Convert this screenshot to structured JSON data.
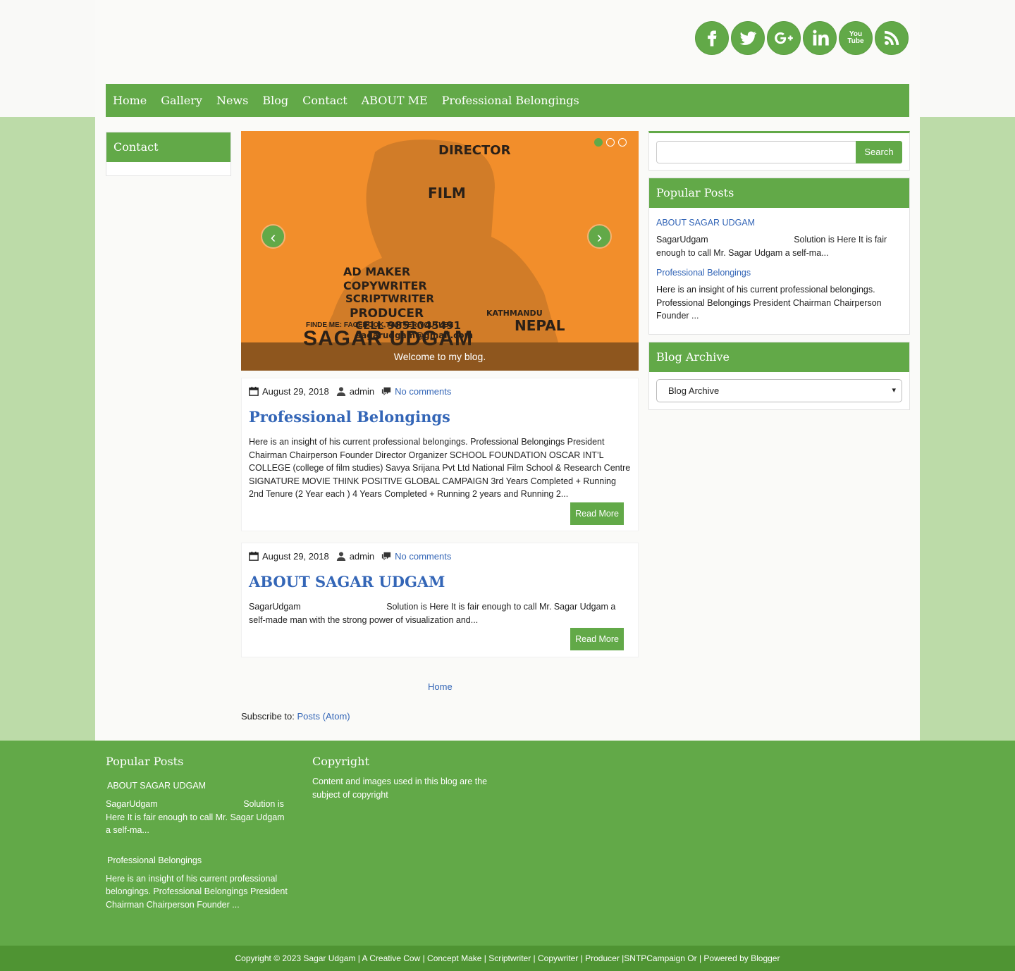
{
  "nav": {
    "items": [
      "Home",
      "Gallery",
      "News",
      "Blog",
      "Contact",
      "ABOUT ME",
      "Professional Belongings"
    ]
  },
  "social": {
    "icons": [
      "facebook-icon",
      "twitter-icon",
      "google-plus-icon",
      "linkedin-icon",
      "youtube-icon",
      "rss-icon"
    ],
    "youtube_text": "You Tube"
  },
  "left_widget": {
    "title": "Contact"
  },
  "slider": {
    "caption": "Welcome to my blog.",
    "art_words": {
      "director": "DIRECTOR",
      "film": "FILM",
      "ad_maker": "AD MAKER",
      "copywriter": "COPYWRITER",
      "scriptwriter": "SCRIPTWRITER",
      "producer": "PRODUCER",
      "cell": "CELL 9851045491",
      "email": "sagarudgam@gmail.com",
      "finde": "FINDE ME: FACEBOOK,TWITTER,YOUTUBE",
      "kathmandu": "KATHMANDU",
      "nepal": "NEPAL",
      "name": "SAGAR UDGAM"
    }
  },
  "posts": [
    {
      "date": "August 29, 2018",
      "author": "admin",
      "comments": "No comments",
      "title": "Professional Belongings",
      "body": "Here is an insight of his current professional belongings.      Professional Belongings President Chairman Chairperson Founder Director Organizer SCHOOL FOUNDATION OSCAR INT’L COLLEGE (college of film studies) Savya Srijana Pvt Ltd National Film School & Research Centre SIGNATURE MOVIE THINK POSITIVE GLOBAL CAMPAIGN 3rd Years Completed + Running 2nd Tenure (2 Year each ) 4 Years Completed + Running 2 years and Running 2...",
      "read_more": "Read More"
    },
    {
      "date": "August 29, 2018",
      "author": "admin",
      "comments": "No comments",
      "title": "ABOUT SAGAR UDGAM",
      "body": "SagarUdgam                                   Solution is Here It is fair enough to call Mr. Sagar Udgam a self-made man with the strong power of visualization and...",
      "read_more": "Read More"
    }
  ],
  "pager": {
    "home": "Home"
  },
  "subscribe": {
    "label": "Subscribe to: ",
    "link": "Posts (Atom)"
  },
  "sidebar": {
    "search_button": "Search",
    "popular_title": "Popular Posts",
    "popular": [
      {
        "title": "ABOUT SAGAR UDGAM",
        "snippet": "SagarUdgam                                   Solution is Here It is fair enough to call Mr. Sagar Udgam a self-ma..."
      },
      {
        "title": "Professional Belongings",
        "snippet": "Here is an insight of his current professional belongings.      Professional Belongings President Chairman Chairperson Founder ..."
      }
    ],
    "archive_title": "Blog Archive",
    "archive_select": "Blog Archive"
  },
  "footer": {
    "popular_title": "Popular Posts",
    "popular": [
      {
        "title": "ABOUT SAGAR UDGAM",
        "snippet": "SagarUdgam                                   Solution is Here It is fair enough to call Mr. Sagar Udgam a self-ma..."
      },
      {
        "title": "Professional Belongings",
        "snippet": "Here is an insight of his current professional belongings.      Professional Belongings President Chairman Chairperson Founder ..."
      }
    ],
    "copyright_title": "Copyright",
    "copyright_text": "Content and images used in this blog are the subject of copyright",
    "bottom_text": "Copyright © 2023 Sagar Udgam | A Creative Cow | Concept Make | Scriptwriter | Copywriter | Producer |SNTPCampaign Or | Powered by Blogger"
  },
  "colors": {
    "accent": "#62a948",
    "link": "#3466b7",
    "slider_bg": "#f28e2b",
    "page_bg": "#bcdba8"
  }
}
